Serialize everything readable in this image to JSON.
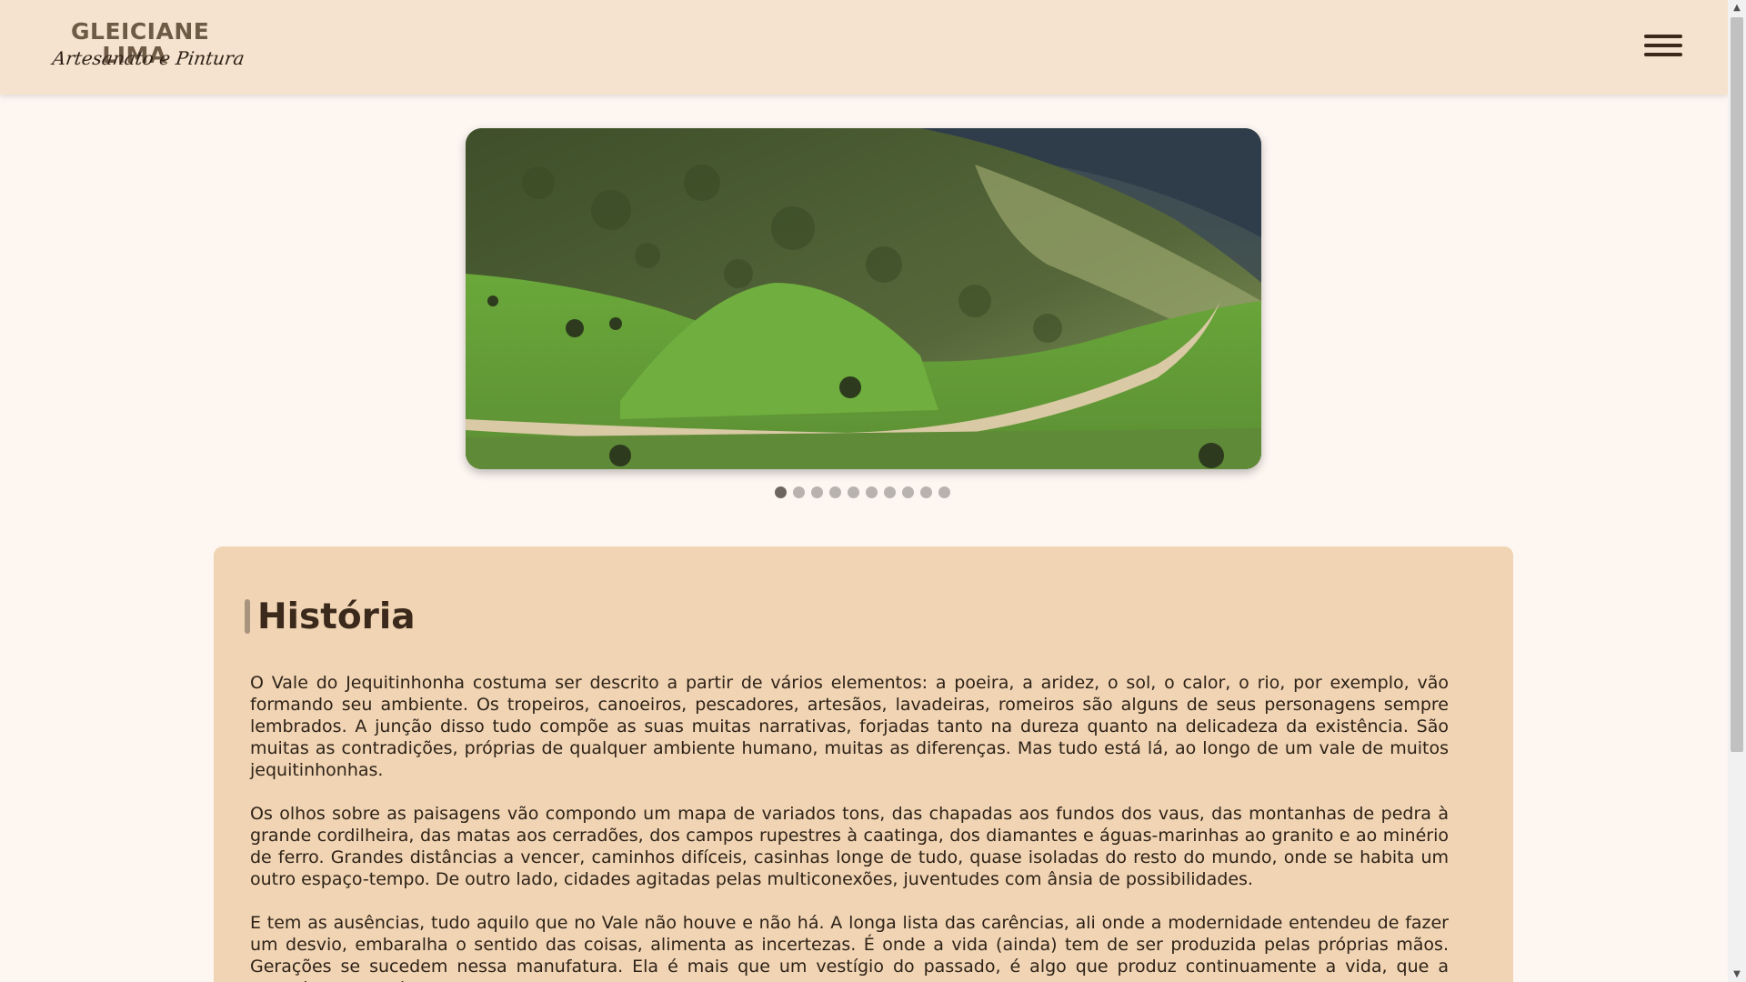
{
  "header": {
    "logo_name": "GLEICIANE LIMA",
    "logo_tagline": "Artesanato e Pintura",
    "menu_icon": "hamburger-menu-icon"
  },
  "carousel": {
    "slide_count": 10,
    "active_index": 0,
    "image_description_icon": "landscape-photo"
  },
  "section": {
    "title": "História",
    "paragraphs": [
      "O Vale do Jequitinhonha costuma ser descrito a partir de vários elementos: a poeira, a aridez, o sol, o calor, o rio, por exemplo, vão formando seu ambiente. Os tropeiros, canoeiros, pescadores, artesãos, lavadeiras, romeiros são alguns de seus personagens sempre lembrados. A junção disso tudo compõe as suas muitas narrativas, forjadas tanto na dureza quanto na delicadeza da existência. São muitas as contradições, próprias de qualquer ambiente humano, muitas as diferenças. Mas tudo está lá, ao longo de um vale de muitos jequitinhonhas.",
      "Os olhos sobre as paisagens vão compondo um mapa de variados tons, das chapadas aos fundos dos vaus, das montanhas de pedra à grande cordilheira, das matas aos cerradões, dos campos rupestres à caatinga, dos diamantes e águas-marinhas ao granito e ao minério de ferro. Grandes distâncias a vencer, caminhos difíceis, casinhas longe de tudo, quase isoladas do resto do mundo, onde se habita um outro espaço-tempo. De outro lado, cidades agitadas pelas multiconexões, juventudes com ânsia de possibilidades.",
      "E tem as ausências, tudo aquilo que no Vale não houve e não há. A longa lista das carências, ali onde a modernidade entendeu de fazer um desvio, embaralha o sentido das coisas, alimenta as incertezas. É onde a vida (ainda) tem de ser produzida pelas próprias mãos. Gerações se sucedem nessa manufatura. Ela é mais que um vestígio do passado, é algo que produz continuamente a vida, que a anuncia, pronuncia"
    ]
  },
  "colors": {
    "header_bg": "#f5e3cf",
    "page_bg": "#fdf6f1",
    "card_bg": "#f0d4b3",
    "text": "#3b2a1c"
  }
}
